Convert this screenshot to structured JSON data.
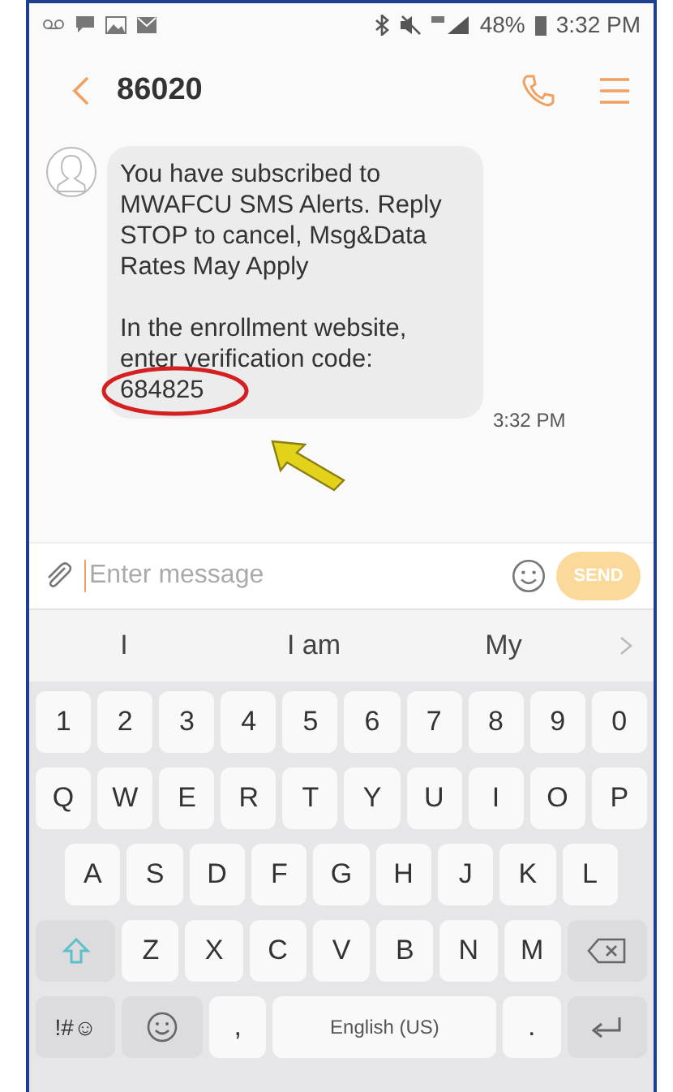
{
  "status_bar": {
    "battery": "48%",
    "time": "3:32 PM"
  },
  "header": {
    "title": "86020"
  },
  "messages": [
    {
      "paragraphs": [
        "You have subscribed to MWAFCU SMS Alerts. Reply STOP to cancel, Msg&Data Rates May Apply",
        "In the enrollment website, enter verification code:"
      ],
      "code": "684825",
      "time": "3:32 PM"
    }
  ],
  "composer": {
    "placeholder": "Enter message",
    "send_label": "SEND",
    "send_disabled": true
  },
  "suggestions": [
    "I",
    "I am",
    "My"
  ],
  "keyboard": {
    "number_row": [
      {
        "kind": "char",
        "label": "1"
      },
      {
        "kind": "char",
        "label": "2"
      },
      {
        "kind": "char",
        "label": "3"
      },
      {
        "kind": "char",
        "label": "4"
      },
      {
        "kind": "char",
        "label": "5"
      },
      {
        "kind": "char",
        "label": "6"
      },
      {
        "kind": "char",
        "label": "7"
      },
      {
        "kind": "char",
        "label": "8"
      },
      {
        "kind": "char",
        "label": "9"
      },
      {
        "kind": "char",
        "label": "0"
      }
    ],
    "top_letter_row": [
      {
        "kind": "char",
        "label": "Q"
      },
      {
        "kind": "char",
        "label": "W"
      },
      {
        "kind": "char",
        "label": "E"
      },
      {
        "kind": "char",
        "label": "R"
      },
      {
        "kind": "char",
        "label": "T"
      },
      {
        "kind": "char",
        "label": "Y"
      },
      {
        "kind": "char",
        "label": "U"
      },
      {
        "kind": "char",
        "label": "I"
      },
      {
        "kind": "char",
        "label": "O"
      },
      {
        "kind": "char",
        "label": "P"
      }
    ],
    "middle_letter_row": [
      {
        "kind": "char",
        "label": "A"
      },
      {
        "kind": "char",
        "label": "S"
      },
      {
        "kind": "char",
        "label": "D"
      },
      {
        "kind": "char",
        "label": "F"
      },
      {
        "kind": "char",
        "label": "G"
      },
      {
        "kind": "char",
        "label": "H"
      },
      {
        "kind": "char",
        "label": "J"
      },
      {
        "kind": "char",
        "label": "K"
      },
      {
        "kind": "char",
        "label": "L"
      }
    ],
    "bottom_letter_row": [
      {
        "kind": "shift"
      },
      {
        "kind": "char",
        "label": "Z"
      },
      {
        "kind": "char",
        "label": "X"
      },
      {
        "kind": "char",
        "label": "C"
      },
      {
        "kind": "char",
        "label": "V"
      },
      {
        "kind": "char",
        "label": "B"
      },
      {
        "kind": "char",
        "label": "N"
      },
      {
        "kind": "char",
        "label": "M"
      },
      {
        "kind": "backspace"
      }
    ],
    "function_row": [
      {
        "kind": "symbols",
        "label": "!#☺"
      },
      {
        "kind": "emoji"
      },
      {
        "kind": "char",
        "label": ","
      },
      {
        "kind": "space",
        "label": "English (US)"
      },
      {
        "kind": "char",
        "label": "."
      },
      {
        "kind": "enter"
      }
    ]
  }
}
